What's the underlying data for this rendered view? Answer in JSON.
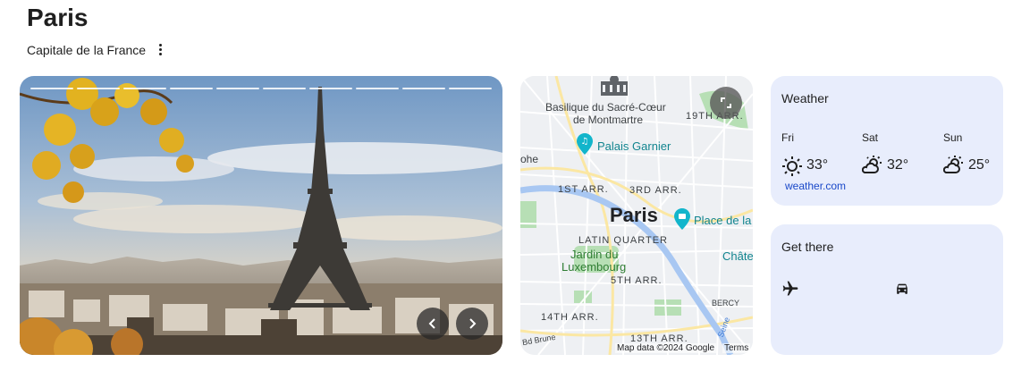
{
  "header": {
    "title": "Paris",
    "subtitle": "Capitale de la France",
    "menu_icon": "more-vert-icon"
  },
  "photo": {
    "progress_segments": 10,
    "prev_icon": "chevron-left-icon",
    "next_icon": "chevron-right-icon"
  },
  "map": {
    "labels": {
      "basilique_1": "Basilique du Sacré-Cœur",
      "basilique_2": "de Montmartre",
      "arr19": "19TH ARR.",
      "palais_garnier": "Palais Garnier",
      "ohe": "ohe",
      "arr1": "1ST ARR.",
      "arr3": "3RD ARR.",
      "city": "Paris",
      "place": "Place de la",
      "latin": "LATIN QUARTER",
      "jardin_1": "Jardin du",
      "jardin_2": "Luxembourg",
      "chate": "Châte",
      "arr5": "5TH ARR.",
      "bercy": "BERCY",
      "arr14": "14TH ARR.",
      "arr13": "13TH ARR.",
      "seine": "Seine",
      "bd": "Bd Brune"
    },
    "attribution": "Map data ©2024 Google",
    "terms": "Terms",
    "expand_icon": "fullscreen-icon"
  },
  "weather": {
    "title": "Weather",
    "days": [
      {
        "day": "Fri",
        "temp": "33°",
        "icon": "sunny-icon"
      },
      {
        "day": "Sat",
        "temp": "32°",
        "icon": "partly-cloudy-icon"
      },
      {
        "day": "Sun",
        "temp": "25°",
        "icon": "partly-cloudy-icon"
      }
    ],
    "source": "weather.com"
  },
  "get_there": {
    "title": "Get there",
    "modes": [
      {
        "icon": "airplane-icon"
      },
      {
        "icon": "car-icon"
      }
    ]
  }
}
